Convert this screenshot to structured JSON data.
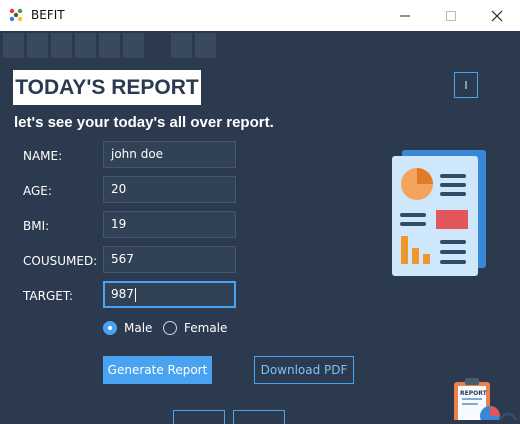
{
  "window": {
    "title": "BEFIT",
    "minimize_icon": "minimize-icon",
    "maximize_icon": "maximize-icon",
    "close_icon": "close-icon"
  },
  "tabs": {
    "count": 9,
    "active_index": 6
  },
  "header": {
    "title": "TODAY'S REPORT",
    "subtitle": "let's see your today's all over report.",
    "corner_button_label": "I"
  },
  "form": {
    "fields": [
      {
        "label": "NAME:",
        "value": "john doe"
      },
      {
        "label": "AGE:",
        "value": "20"
      },
      {
        "label": "BMI:",
        "value": "19"
      },
      {
        "label": "COUSUMED:",
        "value": "567"
      },
      {
        "label": "TARGET:",
        "value": "987"
      }
    ],
    "gender": {
      "options": [
        "Male",
        "Female"
      ],
      "selected": "Male"
    }
  },
  "actions": {
    "generate_label": "Generate Report",
    "download_label": "Download PDF"
  },
  "illustrations": {
    "report_graphic": "report-document-illustration-icon",
    "clipboard_graphic": "report-clipboard-icon",
    "clipboard_text": "REPORT"
  },
  "colors": {
    "background": "#2b3a4e",
    "accent": "#4aa3f0",
    "title_bg": "#ffffff"
  }
}
